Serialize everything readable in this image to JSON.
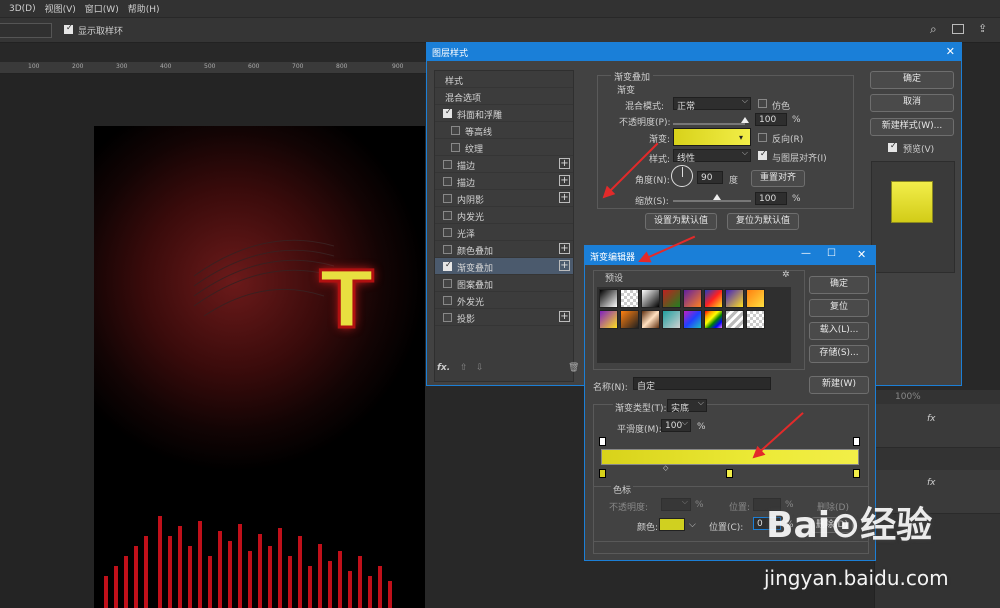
{
  "menu": [
    "3D(D)",
    "视图(V)",
    "窗口(W)",
    "帮助(H)"
  ],
  "options": {
    "show_ring": "显示取样环"
  },
  "ruler": [
    "100",
    "200",
    "300",
    "400",
    "500",
    "600",
    "700",
    "800",
    "900"
  ],
  "canvas": {
    "letter": "T"
  },
  "layer_style": {
    "title": "图层样式",
    "styles": [
      {
        "label": "样式",
        "checkbox": false,
        "plus": false,
        "selected": false,
        "indent": false,
        "hascb": false
      },
      {
        "label": "混合选项",
        "checkbox": false,
        "plus": false,
        "selected": false,
        "indent": false,
        "hascb": false
      },
      {
        "label": "斜面和浮雕",
        "checkbox": true,
        "plus": false,
        "selected": false,
        "indent": false,
        "hascb": true
      },
      {
        "label": "等高线",
        "checkbox": false,
        "plus": false,
        "selected": false,
        "indent": true,
        "hascb": true
      },
      {
        "label": "纹理",
        "checkbox": false,
        "plus": false,
        "selected": false,
        "indent": true,
        "hascb": true
      },
      {
        "label": "描边",
        "checkbox": false,
        "plus": true,
        "selected": false,
        "indent": false,
        "hascb": true
      },
      {
        "label": "描边",
        "checkbox": false,
        "plus": true,
        "selected": false,
        "indent": false,
        "hascb": true
      },
      {
        "label": "内阴影",
        "checkbox": false,
        "plus": true,
        "selected": false,
        "indent": false,
        "hascb": true
      },
      {
        "label": "内发光",
        "checkbox": false,
        "plus": false,
        "selected": false,
        "indent": false,
        "hascb": true
      },
      {
        "label": "光泽",
        "checkbox": false,
        "plus": false,
        "selected": false,
        "indent": false,
        "hascb": true
      },
      {
        "label": "颜色叠加",
        "checkbox": false,
        "plus": true,
        "selected": false,
        "indent": false,
        "hascb": true
      },
      {
        "label": "渐变叠加",
        "checkbox": true,
        "plus": true,
        "selected": true,
        "indent": false,
        "hascb": true
      },
      {
        "label": "图案叠加",
        "checkbox": false,
        "plus": false,
        "selected": false,
        "indent": false,
        "hascb": true
      },
      {
        "label": "外发光",
        "checkbox": false,
        "plus": false,
        "selected": false,
        "indent": false,
        "hascb": true
      },
      {
        "label": "投影",
        "checkbox": false,
        "plus": true,
        "selected": false,
        "indent": false,
        "hascb": true
      }
    ],
    "fx": "fx.",
    "group_title": "渐变叠加",
    "sub_title": "渐变",
    "blend_label": "混合模式:",
    "blend_value": "正常",
    "dither": "仿色",
    "opacity_label": "不透明度(P):",
    "opacity_value": "100",
    "percent": "%",
    "gradient_label": "渐变:",
    "reverse": "反向(R)",
    "style_label": "样式:",
    "style_value": "线性",
    "align_layer": "与图层对齐(I)",
    "angle_label": "角度(N):",
    "angle_value": "90",
    "degree": "度",
    "reset_align": "重置对齐",
    "scale_label": "缩放(S):",
    "scale_value": "100",
    "set_default": "设置为默认值",
    "reset_default": "复位为默认值",
    "ok": "确定",
    "cancel": "取消",
    "new_style": "新建样式(W)...",
    "preview": "预览(V)"
  },
  "gradient_editor": {
    "title": "渐变编辑器",
    "presets_label": "预设",
    "gear": "✲",
    "ok": "确定",
    "reset": "复位",
    "load": "载入(L)...",
    "save": "存储(S)...",
    "name_label": "名称(N):",
    "name_value": "自定",
    "new_btn": "新建(W)",
    "type_label": "渐变类型(T):",
    "type_value": "实底",
    "smooth_label": "平滑度(M):",
    "smooth_value": "100",
    "percent": "%",
    "stops_title": "色标",
    "stop_opacity_label": "不透明度:",
    "stop_pos_label": "位置:",
    "stop_delete": "删除(D)",
    "color_label": "颜色:",
    "color_pos_label": "位置(C):",
    "color_pos_value": "0",
    "color_delete": "删除(D)"
  },
  "right_panel": {
    "zoom": "100%",
    "fx": "fx"
  },
  "watermark": {
    "brand": "Bai⊙经验",
    "url": "jingyan.baidu.com"
  }
}
